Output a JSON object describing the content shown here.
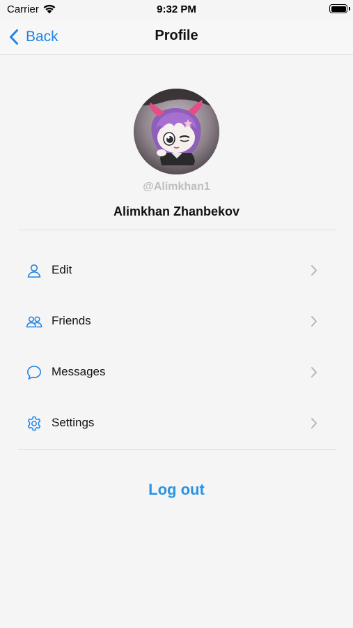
{
  "status_bar": {
    "carrier": "Carrier",
    "time": "9:32 PM"
  },
  "nav": {
    "back_label": "Back",
    "title": "Profile"
  },
  "profile": {
    "username": "@Alimkhan1",
    "full_name": "Alimkhan Zhanbekov"
  },
  "menu": {
    "items": [
      {
        "label": "Edit",
        "icon": "person-icon"
      },
      {
        "label": "Friends",
        "icon": "people-icon"
      },
      {
        "label": "Messages",
        "icon": "chat-bubble-icon"
      },
      {
        "label": "Settings",
        "icon": "gear-icon"
      }
    ]
  },
  "actions": {
    "logout_label": "Log out"
  },
  "colors": {
    "accent": "#1f84e6",
    "background": "#f5f5f5",
    "divider": "#dedede",
    "muted_text": "#bdbdbd"
  }
}
